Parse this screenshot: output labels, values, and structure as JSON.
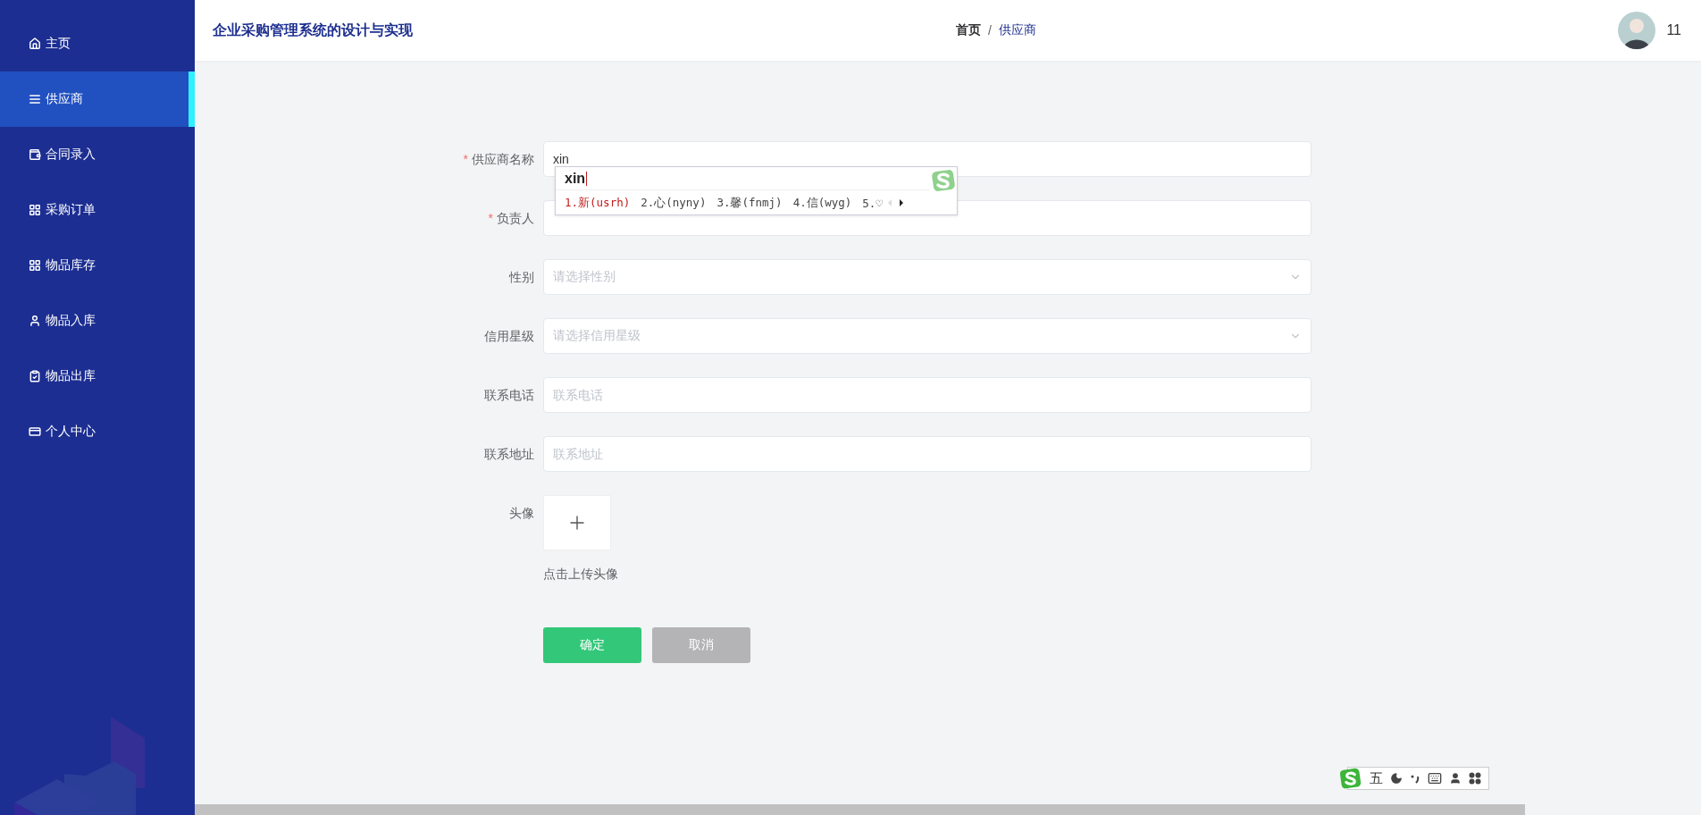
{
  "sidebar": {
    "items": [
      {
        "label": "主页",
        "kind": "home",
        "selected": false
      },
      {
        "label": "供应商",
        "kind": "list",
        "selected": true
      },
      {
        "label": "合同录入",
        "kind": "wallet",
        "selected": false
      },
      {
        "label": "采购订单",
        "kind": "grid",
        "selected": false
      },
      {
        "label": "物品库存",
        "kind": "grid",
        "selected": false
      },
      {
        "label": "物品入库",
        "kind": "user",
        "selected": false
      },
      {
        "label": "物品出库",
        "kind": "clipboard",
        "selected": false
      },
      {
        "label": "个人中心",
        "kind": "card",
        "selected": false
      }
    ]
  },
  "header": {
    "title": "企业采购管理系统的设计与实现",
    "breadcrumb_separator": "/",
    "breadcrumb": [
      {
        "label": "首页",
        "current": false
      },
      {
        "label": "供应商",
        "current": true
      }
    ],
    "user": {
      "name": "11"
    }
  },
  "form": {
    "fields": [
      {
        "kind": "input",
        "label": "供应商名称",
        "required_mark": "*",
        "value": "xin"
      },
      {
        "kind": "input",
        "label": "负责人",
        "required_mark": "*"
      },
      {
        "kind": "select",
        "label": "性别",
        "placeholder": "请选择性别"
      },
      {
        "kind": "select",
        "label": "信用星级",
        "placeholder": "请选择信用星级"
      },
      {
        "kind": "input",
        "label": "联系电话",
        "placeholder": "联系电话"
      },
      {
        "kind": "input",
        "label": "联系地址",
        "placeholder": "联系地址"
      },
      {
        "kind": "upload",
        "label": "头像",
        "caption": "点击上传头像"
      }
    ],
    "buttons": [
      {
        "label": "确定",
        "kind": "primary"
      },
      {
        "label": "取消",
        "kind": "secondary"
      }
    ]
  },
  "ime_popup": {
    "composition": "xin",
    "candidates": [
      {
        "text": "1.新(usrh)",
        "selected": true
      },
      {
        "text": "2.心(nyny)",
        "selected": false
      },
      {
        "text": "3.馨(fnmj)",
        "selected": false
      },
      {
        "text": "4.信(wyg)",
        "selected": false
      },
      {
        "text": "5.♡",
        "selected": false
      }
    ]
  },
  "ime_toolbar": {
    "mode": "五"
  }
}
